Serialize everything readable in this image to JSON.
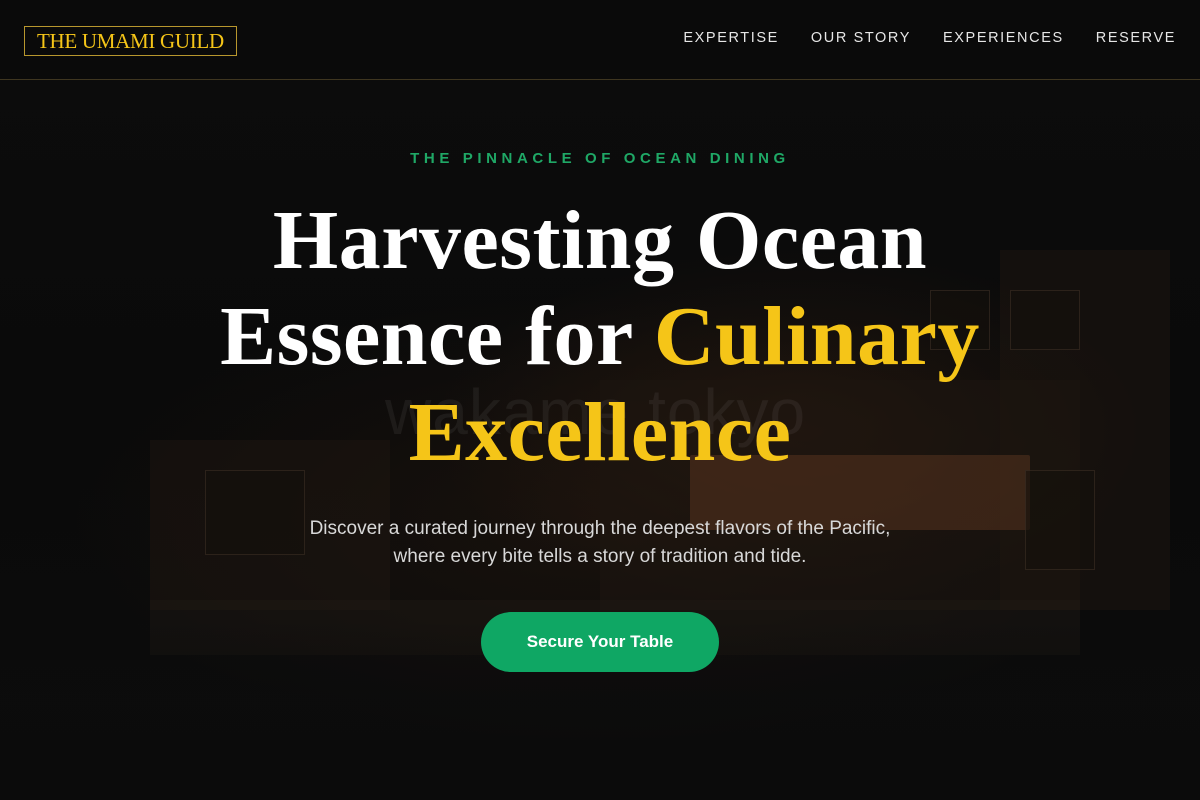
{
  "brand": {
    "logo_text": "THE UMAMI GUILD",
    "accent_color": "#f5c518",
    "cta_color": "#0fa764",
    "eyebrow_color": "#1fa866"
  },
  "nav": {
    "items": [
      {
        "label": "EXPERTISE"
      },
      {
        "label": "OUR STORY"
      },
      {
        "label": "EXPERIENCES"
      },
      {
        "label": "RESERVE"
      }
    ]
  },
  "hero": {
    "eyebrow": "THE PINNACLE OF OCEAN DINING",
    "title_line1": "Harvesting Ocean",
    "title_line2_plain": "Essence for ",
    "title_line2_accent": "Culinary",
    "title_line3_accent": "Excellence",
    "subtitle_line1": "Discover a curated journey through the deepest flavors of the Pacific,",
    "subtitle_line2": "where every bite tells a story of tradition and tide.",
    "cta_label": "Secure Your Table"
  },
  "background": {
    "sign_text": "wakame tokyo"
  }
}
